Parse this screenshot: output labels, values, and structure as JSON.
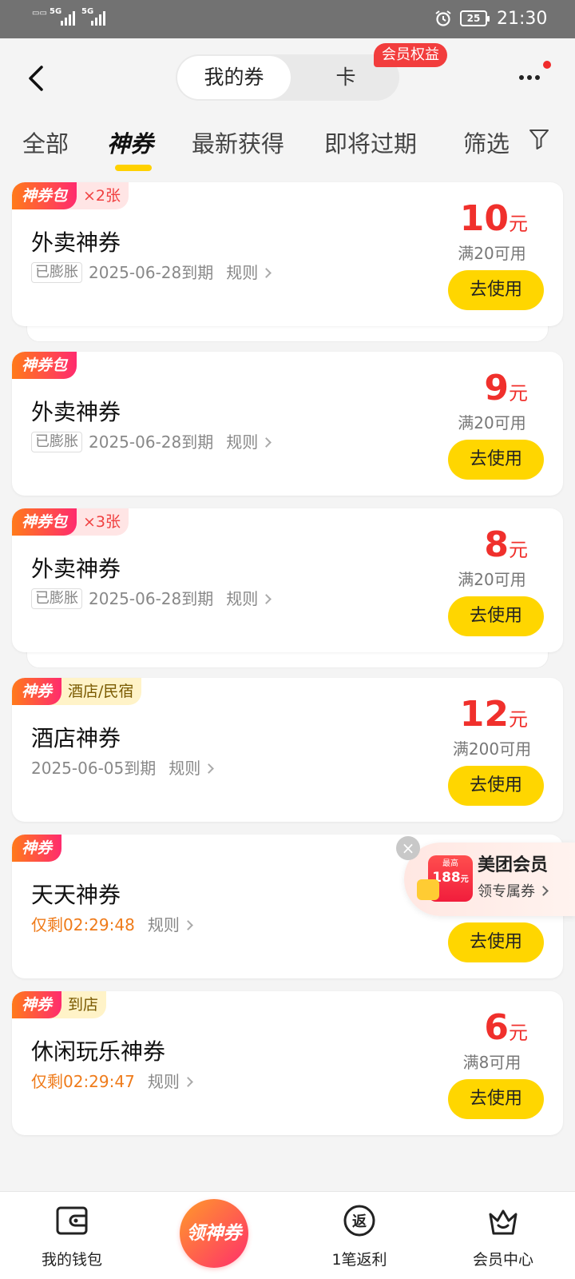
{
  "status_bar": {
    "network1": "5G",
    "network2": "5G",
    "battery": "25",
    "time": "21:30"
  },
  "header": {
    "segment_active": "我的券",
    "segment_inactive": "卡",
    "vip_badge": "会员权益"
  },
  "tabs": [
    {
      "label": "全部"
    },
    {
      "label": "神券"
    },
    {
      "label": "最新获得"
    },
    {
      "label": "即将过期"
    },
    {
      "label": "筛选"
    }
  ],
  "coupons": [
    {
      "tag": "神券包",
      "count": "×2张",
      "title": "外卖神券",
      "status": "已膨胀",
      "expiry": "2025-06-28到期",
      "rules": "规则",
      "amount": "10",
      "unit": "元",
      "condition": "满20可用",
      "button": "去使用"
    },
    {
      "tag": "神券包",
      "title": "外卖神券",
      "status": "已膨胀",
      "expiry": "2025-06-28到期",
      "rules": "规则",
      "amount": "9",
      "unit": "元",
      "condition": "满20可用",
      "button": "去使用"
    },
    {
      "tag": "神券包",
      "count": "×3张",
      "title": "外卖神券",
      "status": "已膨胀",
      "expiry": "2025-06-28到期",
      "rules": "规则",
      "amount": "8",
      "unit": "元",
      "condition": "满20可用",
      "button": "去使用"
    },
    {
      "tag": "神券",
      "category": "酒店/民宿",
      "title": "酒店神券",
      "expiry": "2025-06-05到期",
      "rules": "规则",
      "amount": "12",
      "unit": "元",
      "condition": "满200可用",
      "button": "去使用"
    },
    {
      "tag": "神券",
      "title": "天天神券",
      "countdown": "仅剩02:29:48",
      "rules": "规则",
      "button": "去使用"
    },
    {
      "tag": "神券",
      "category": "到店",
      "title": "休闲玩乐神券",
      "countdown": "仅剩02:29:47",
      "rules": "规则",
      "amount": "6",
      "unit": "元",
      "condition": "满8可用",
      "button": "去使用"
    }
  ],
  "float_promo": {
    "small": "最高",
    "value": "188",
    "unit": "元",
    "title": "美团会员",
    "subtitle": "领专属券"
  },
  "bottom_nav": {
    "wallet": "我的钱包",
    "center": "领神券",
    "rebate": "1笔返利",
    "rebate_icon": "返",
    "member": "会员中心"
  },
  "colors": {
    "accent": "#ffd600",
    "price": "#f0302c",
    "badge": "#f23d3d",
    "countdown": "#ef7b1a"
  }
}
